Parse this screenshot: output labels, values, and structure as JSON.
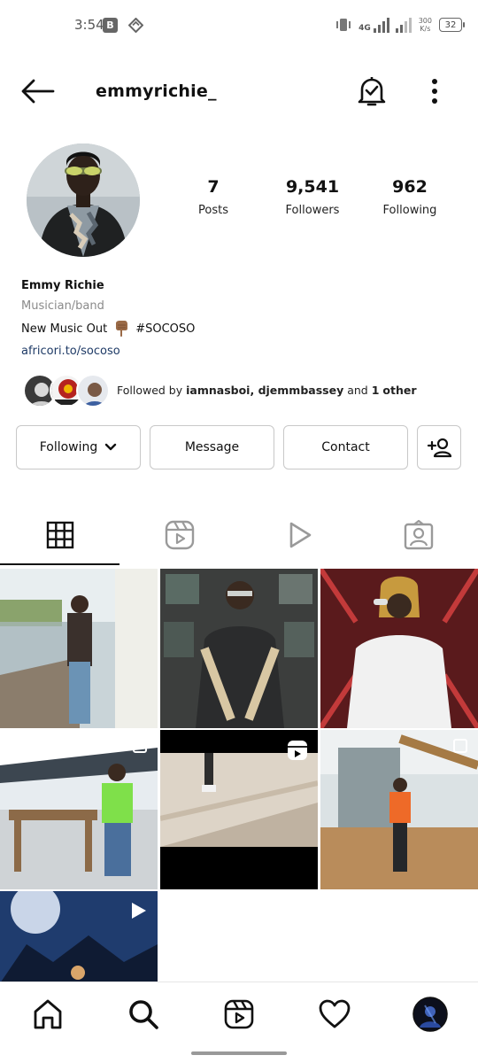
{
  "status_bar": {
    "time": "3:54",
    "app_badge_letter": "B",
    "network_type": "4G",
    "speed_value": "300",
    "speed_unit": "K/s",
    "battery": "32"
  },
  "header": {
    "username": "emmyrichie_"
  },
  "stats": {
    "posts_count": "7",
    "posts_label": "Posts",
    "followers_count": "9,541",
    "followers_label": "Followers",
    "following_count": "962",
    "following_label": "Following"
  },
  "bio": {
    "name": "Emmy Richie",
    "category": "Musician/band",
    "text_before": "New Music Out",
    "text_after": "#SOCOSO",
    "link": "africori.to/socoso"
  },
  "followed_by": {
    "prefix": "Followed by",
    "names": "iamnasboi, djemmbassey",
    "middle": "and",
    "count": "1",
    "suffix": "other"
  },
  "buttons": {
    "following": "Following",
    "message": "Message",
    "contact": "Contact"
  },
  "icons": {
    "back": "arrow-left-icon",
    "bell": "bell-check-icon",
    "more": "more-vertical-icon",
    "grid_tab": "grid-icon",
    "reels_tab": "reels-icon",
    "videos_tab": "play-icon",
    "tagged_tab": "tagged-person-icon",
    "home": "home-icon",
    "search": "search-icon",
    "reels": "reels-icon",
    "activity": "heart-icon",
    "add_person": "add-person-icon"
  },
  "colors": {
    "link": "#1e3a66",
    "secondary_text": "#8a8a8a",
    "border": "#c8c8c8"
  }
}
